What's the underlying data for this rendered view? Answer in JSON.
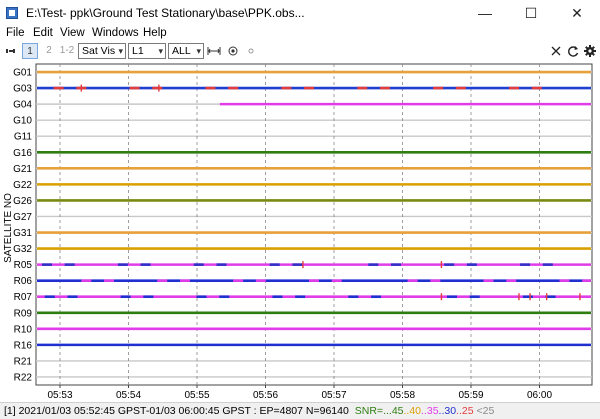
{
  "window": {
    "title": "E:\\Test- ppk\\Ground Test Stationary\\base\\PPK.obs...",
    "minimize_glyph": "—",
    "maximize_glyph": "☐",
    "close_glyph": "✕"
  },
  "menu": [
    "File",
    "Edit",
    "View",
    "Windows",
    "Help"
  ],
  "toolbar": {
    "btn1": "1",
    "btn2": "2",
    "btn12": "1-2",
    "plot_type": "Sat Vis",
    "frequency": "L1",
    "satellites": "ALL",
    "dropdown_glyph": "▾"
  },
  "plot": {
    "y_axis_label": "SATELLITE NO",
    "satellites": [
      "G01",
      "G03",
      "G04",
      "G10",
      "G11",
      "G16",
      "G21",
      "G22",
      "G26",
      "G27",
      "G31",
      "G32",
      "R05",
      "R06",
      "R07",
      "R09",
      "R10",
      "R16",
      "R21",
      "R22"
    ],
    "time_ticks": [
      "05:53",
      "05:54",
      "05:55",
      "05:56",
      "05:57",
      "05:58",
      "05:59",
      "06:00"
    ],
    "tracks": [
      {
        "sat": "G01",
        "start": 0.0,
        "end": 1.0,
        "color": "#e7a13a"
      },
      {
        "sat": "G03",
        "start": 0.0,
        "end": 1.0,
        "color": "#1f3fd0",
        "accent": "#e23c3c",
        "slips": [
          0.08,
          0.22
        ]
      },
      {
        "sat": "G04",
        "start": 0.33,
        "end": 1.0,
        "color": "#e03ce8"
      },
      {
        "sat": "G16",
        "start": 0.0,
        "end": 1.0,
        "color": "#2e7d10"
      },
      {
        "sat": "G21",
        "start": 0.0,
        "end": 1.0,
        "color": "#e7a13a"
      },
      {
        "sat": "G22",
        "start": 0.0,
        "end": 1.0,
        "color": "#d9a000"
      },
      {
        "sat": "G26",
        "start": 0.0,
        "end": 1.0,
        "color": "#7a8a10"
      },
      {
        "sat": "G31",
        "start": 0.0,
        "end": 1.0,
        "color": "#e7a13a"
      },
      {
        "sat": "G32",
        "start": 0.0,
        "end": 1.0,
        "color": "#d9a000"
      },
      {
        "sat": "R05",
        "start": 0.0,
        "end": 1.0,
        "color": "#e03ce8",
        "accent": "#3030c8",
        "slips": [
          0.48,
          0.73
        ]
      },
      {
        "sat": "R06",
        "start": 0.0,
        "end": 1.0,
        "color": "#2030d0",
        "accent": "#e03ce8"
      },
      {
        "sat": "R07",
        "start": 0.0,
        "end": 1.0,
        "color": "#e03ce8",
        "accent": "#2030d0",
        "slips": [
          0.73,
          0.87,
          0.89,
          0.92,
          0.98
        ]
      },
      {
        "sat": "R09",
        "start": 0.0,
        "end": 1.0,
        "color": "#2e7d10"
      },
      {
        "sat": "R10",
        "start": 0.0,
        "end": 1.0,
        "color": "#e03ce8"
      },
      {
        "sat": "R16",
        "start": 0.0,
        "end": 1.0,
        "color": "#2030d0"
      }
    ]
  },
  "status": {
    "main": "[1] 2021/01/03 05:52:45 GPST-01/03 06:00:45 GPST : EP=4807 N=96140",
    "snr_label": "SNR=",
    "snr_legend": [
      {
        "text": "...45",
        "color": "#2e7d10"
      },
      {
        "text": "..40",
        "color": "#d9a000"
      },
      {
        "text": "..35",
        "color": "#e03ce8"
      },
      {
        "text": "..30",
        "color": "#2030d0"
      },
      {
        "text": "..25",
        "color": "#e23c3c"
      },
      {
        "text": " <25",
        "color": "#8a8a8a"
      }
    ]
  }
}
